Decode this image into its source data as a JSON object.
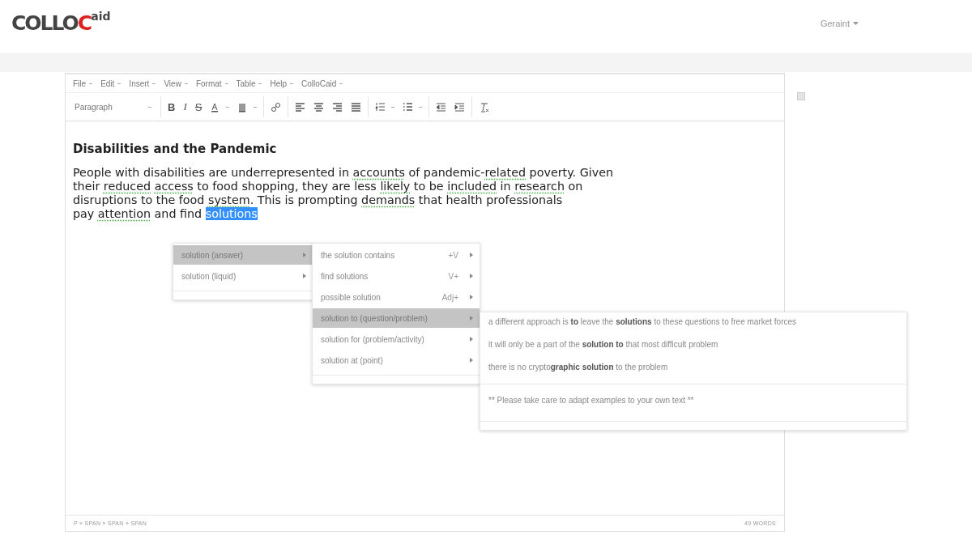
{
  "header": {
    "logo": [
      "COLLO",
      "C",
      "aid"
    ],
    "user_menu": "Geraint"
  },
  "editor": {
    "menubar": [
      "File",
      "Edit",
      "Insert",
      "View",
      "Format",
      "Table",
      "Help",
      "ColloCaid"
    ],
    "toolbar": [
      {
        "kind": "dropdown",
        "label": "Paragraph"
      },
      {
        "kind": "bold",
        "label": "B"
      },
      {
        "kind": "italic",
        "label": "I"
      },
      {
        "kind": "strike",
        "label": "S"
      },
      {
        "kind": "textcolor"
      },
      {
        "kind": "bgcolor"
      },
      {
        "kind": "link"
      },
      {
        "kind": "align-left"
      },
      {
        "kind": "align-center"
      },
      {
        "kind": "align-right"
      },
      {
        "kind": "justify"
      },
      {
        "kind": "numlist"
      },
      {
        "kind": "bullist"
      },
      {
        "kind": "outdent"
      },
      {
        "kind": "indent"
      },
      {
        "kind": "clear"
      }
    ],
    "heading": "Disabilities and the Pandemic",
    "lines": [
      [
        {
          "kind": "plain",
          "text": "People with disabilities are underrepresented in "
        },
        {
          "kind": "flag",
          "text": "accounts"
        },
        {
          "kind": "plain",
          "text": " of pandemic-"
        },
        {
          "kind": "flag",
          "text": "related"
        },
        {
          "kind": "plain",
          "text": " poverty. Given"
        }
      ],
      [
        {
          "kind": "plain",
          "text": "their "
        },
        {
          "kind": "flag",
          "text": "reduced access"
        },
        {
          "kind": "plain",
          "text": " to food shopping, they are less "
        },
        {
          "kind": "flag",
          "text": "likely"
        },
        {
          "kind": "plain",
          "text": " to be "
        },
        {
          "kind": "flag",
          "text": "included"
        },
        {
          "kind": "plain",
          "text": " in "
        },
        {
          "kind": "flag",
          "text": "research"
        },
        {
          "kind": "plain",
          "text": " on"
        }
      ],
      [
        {
          "kind": "plain",
          "text": "disruptions to the food "
        },
        {
          "kind": "flag",
          "text": "system"
        },
        {
          "kind": "plain",
          "text": ". This is prompting "
        },
        {
          "kind": "flag",
          "text": "demands"
        },
        {
          "kind": "plain",
          "text": " that health professionals"
        }
      ],
      [
        {
          "kind": "plain",
          "text": "pay "
        },
        {
          "kind": "flag",
          "text": "attention"
        },
        {
          "kind": "plain",
          "text": " and find "
        },
        {
          "kind": "selected",
          "text": "solutions"
        }
      ]
    ],
    "path": "P » SPAN » SPAN » SPAN",
    "word_count": "49 WORDS"
  },
  "menu_senses": [
    {
      "label": "solution (answer)",
      "selected": true
    },
    {
      "label": "solution (liquid)",
      "selected": false
    }
  ],
  "menu_patterns": [
    {
      "label": "the solution contains",
      "tag": "+V",
      "selected": false
    },
    {
      "label": "find solutions",
      "tag": "V+",
      "selected": false
    },
    {
      "label": "possible solution",
      "tag": "Adj+",
      "selected": false
    },
    {
      "label": "solution to (question/problem)",
      "selected": true
    },
    {
      "label": "solution for (problem/activity)",
      "selected": false
    },
    {
      "label": "solution at (point)",
      "selected": false
    }
  ],
  "menu_examples": {
    "examples": [
      "a different approach is **to** leave the **solutions** to these questions to free market forces",
      "it will only be a part of the **solution to** that most difficult problem",
      "there is no crypto**graphic** **solution** to the problem"
    ],
    "note": "** Please take care to adapt examples to your own text **"
  }
}
